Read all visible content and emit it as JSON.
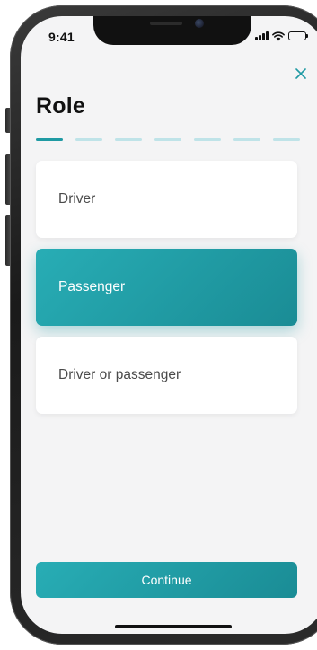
{
  "status_bar": {
    "time": "9:41",
    "icons": [
      "signal-icon",
      "wifi-icon",
      "battery-icon"
    ]
  },
  "header": {
    "title": "Role",
    "close_icon": "close-icon"
  },
  "progress": {
    "total_steps": 7,
    "current_step": 1
  },
  "options": [
    {
      "label": "Driver",
      "selected": false
    },
    {
      "label": "Passenger",
      "selected": true
    },
    {
      "label": "Driver or passenger",
      "selected": false
    }
  ],
  "footer": {
    "continue_label": "Continue"
  },
  "colors": {
    "accent": "#1f9aa3",
    "accent_light": "#bfe3e8",
    "screen_background": "#f4f4f5",
    "card_background": "#ffffff"
  }
}
